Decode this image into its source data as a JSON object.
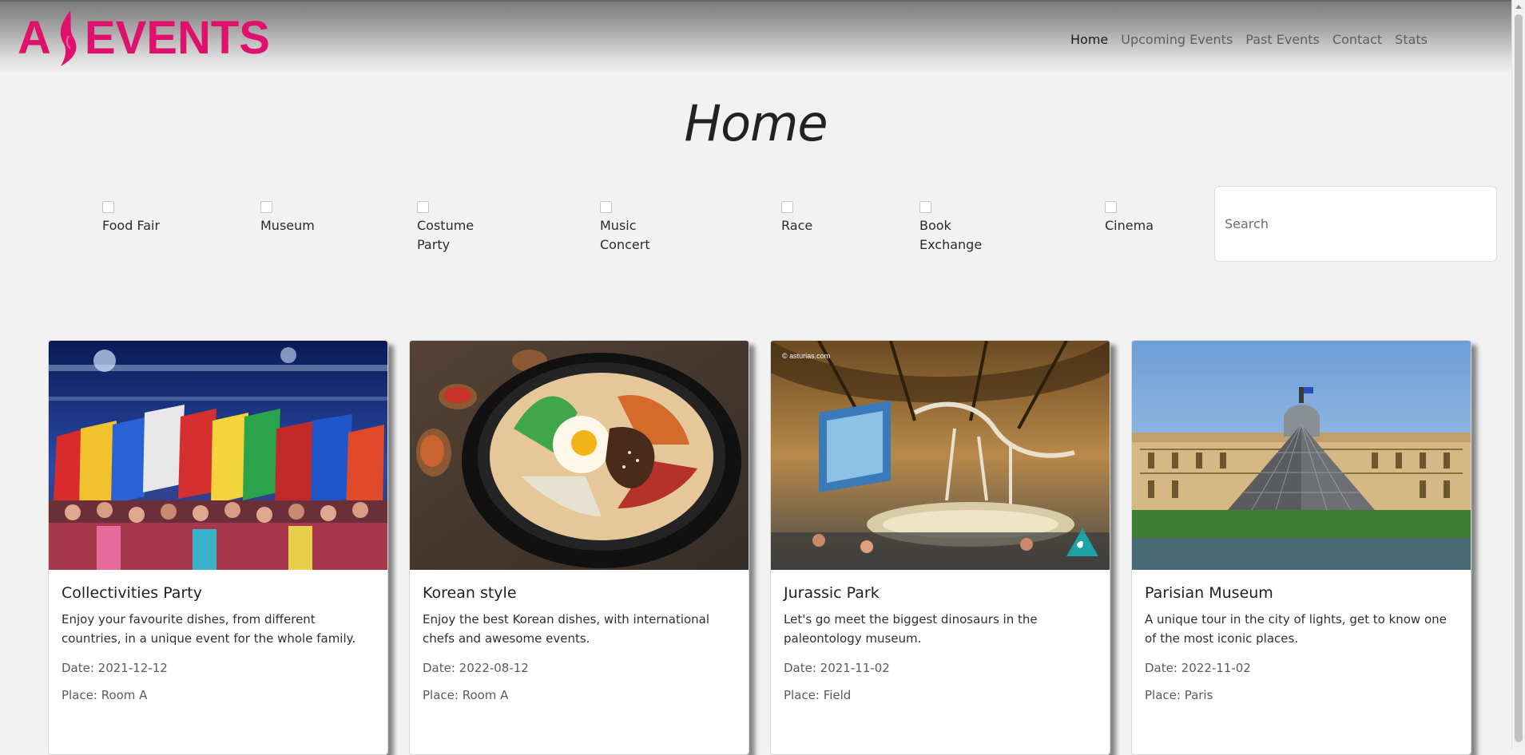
{
  "brand": {
    "logo_left": "A",
    "logo_right": "EVENTS",
    "color": "#e0116d"
  },
  "nav": {
    "items": [
      {
        "label": "Home",
        "active": true
      },
      {
        "label": "Upcoming Events",
        "active": false
      },
      {
        "label": "Past Events",
        "active": false
      },
      {
        "label": "Contact",
        "active": false
      },
      {
        "label": "Stats",
        "active": false
      }
    ]
  },
  "page": {
    "title": "Home"
  },
  "filters": [
    {
      "label": "Food Fair",
      "checked": false
    },
    {
      "label": "Museum",
      "checked": false
    },
    {
      "label": "Costume Party",
      "checked": false
    },
    {
      "label": "Music Concert",
      "checked": false
    },
    {
      "label": "Race",
      "checked": false
    },
    {
      "label": "Book Exchange",
      "checked": false
    },
    {
      "label": "Cinema",
      "checked": false
    }
  ],
  "search": {
    "placeholder": "Search",
    "value": ""
  },
  "cards": [
    {
      "title": "Collectivities Party",
      "description": "Enjoy your favourite dishes, from different countries, in a unique event for the whole family.",
      "date": "Date: 2021-12-12",
      "place": "Place: Room A",
      "image": "flags-parade-image"
    },
    {
      "title": "Korean style",
      "description": "Enjoy the best Korean dishes, with international chefs and awesome events.",
      "date": "Date: 2022-08-12",
      "place": "Place: Room A",
      "image": "bibimbap-image"
    },
    {
      "title": "Jurassic Park",
      "description": "Let's go meet the biggest dinosaurs in the paleontology museum.",
      "date": "Date: 2021-11-02",
      "place": "Place: Field",
      "image": "dinosaur-museum-image",
      "image_watermark": "© asturias.com"
    },
    {
      "title": "Parisian Museum",
      "description": "A unique tour in the city of lights, get to know one of the most iconic places.",
      "date": "Date: 2022-11-02",
      "place": "Place: Paris",
      "image": "louvre-pyramid-image"
    }
  ]
}
